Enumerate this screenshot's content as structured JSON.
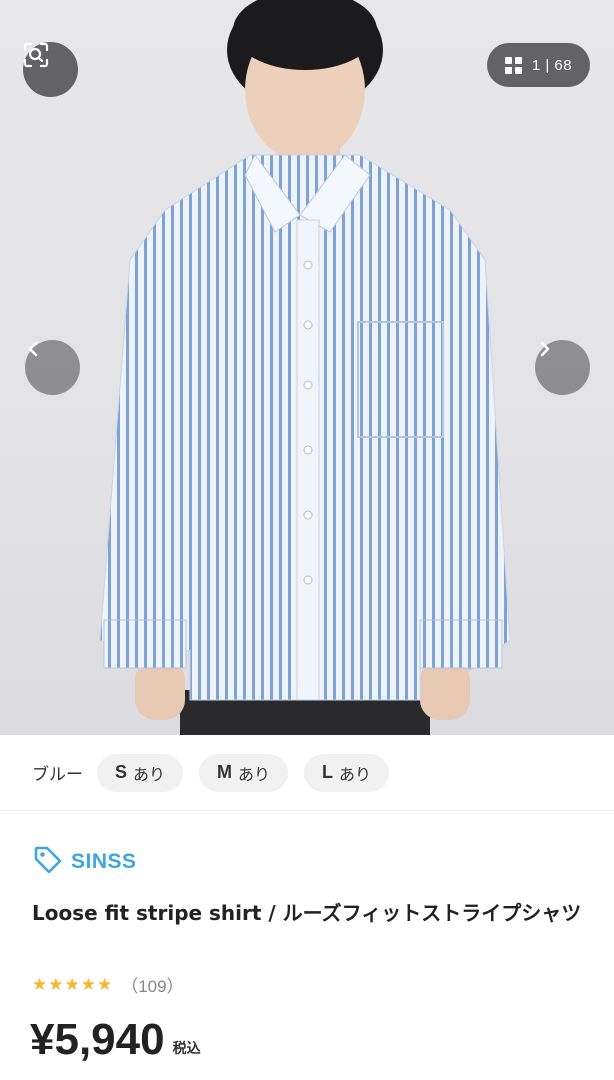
{
  "gallery": {
    "counter_text": "1 | 68",
    "icons": {
      "lens": "image-search-icon",
      "grid": "grid-icon",
      "prev": "chevron-left-icon",
      "next": "chevron-right-icon"
    }
  },
  "variants": {
    "color": "ブルー",
    "sizes": [
      {
        "size": "S",
        "stock": "あり"
      },
      {
        "size": "M",
        "stock": "あり"
      },
      {
        "size": "L",
        "stock": "あり"
      }
    ]
  },
  "product": {
    "brand": "SINSS",
    "brand_icon": "tag-icon",
    "title": "Loose fit stripe shirt / ルーズフィットストライプシャツ",
    "stars": "★★★★★",
    "review_count": "（109）",
    "price": "¥5,940",
    "tax_label": "税込"
  },
  "colors": {
    "brand_accent": "#3fa6dd",
    "star": "#f4b82a",
    "shirt_stripe": "#7fa2d6"
  }
}
